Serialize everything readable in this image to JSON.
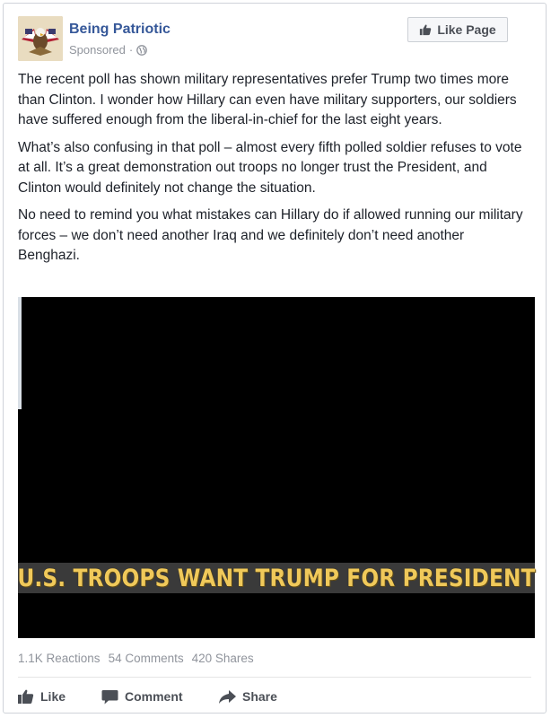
{
  "post": {
    "page_name": "Being Patriotic",
    "sponsored": "Sponsored",
    "separator": "·",
    "audience_icon": "globe-icon",
    "like_page_label": "Like Page",
    "paragraphs": [
      "The recent poll has shown military representatives prefer Trump two times more than Clinton. I wonder how Hillary can even have military supporters, our soldiers have suffered enough from the liberal-in-chief for the last eight years.",
      "What’s also confusing in that poll – almost every fifth polled soldier refuses to vote at all. It’s a great demonstration out troops no longer trust the President, and Clinton would definitely not change the situation.",
      "No need to remind you what mistakes can Hillary do if allowed running our military forces – we don’t need another Iraq and we definitely don’t need another Benghazi."
    ],
    "image_caption": "U.S. TROOPS WANT TRUMP FOR PRESIDENT"
  },
  "stats": {
    "reactions": "1.1K Reactions",
    "comments": "54 Comments",
    "shares": "420 Shares"
  },
  "actions": {
    "like": "Like",
    "comment": "Comment",
    "share": "Share"
  },
  "colors": {
    "brand_link": "#365899",
    "muted": "#90949c",
    "caption_gold": "#f0c95a"
  }
}
